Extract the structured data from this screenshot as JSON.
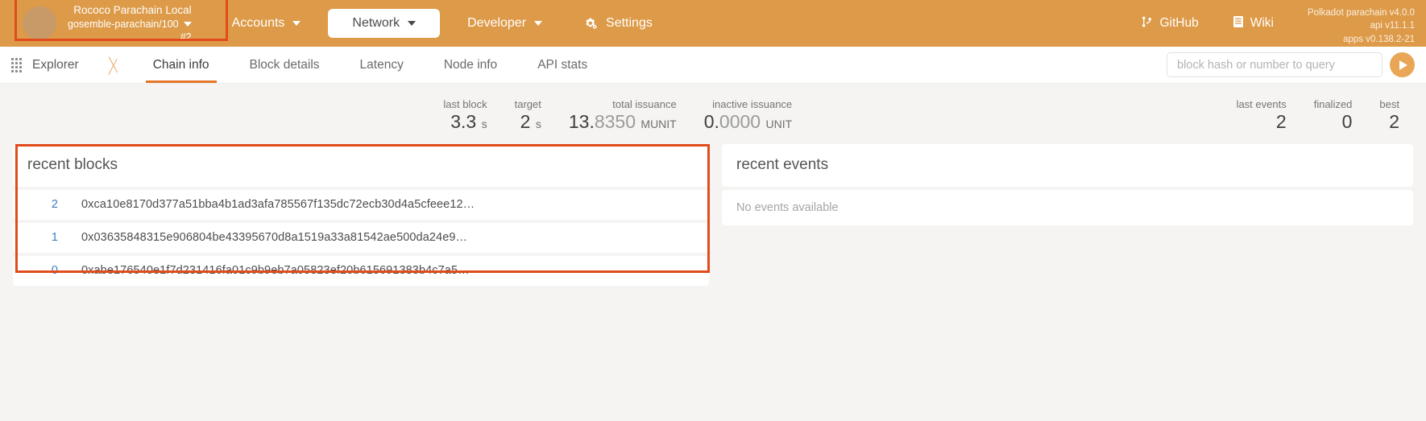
{
  "header": {
    "chain": {
      "name": "Rococo Parachain Local",
      "spec": "gosemble-parachain/100",
      "block": "#2",
      "caret_icon": "chevron-down-icon"
    },
    "nav": [
      {
        "label": "Accounts",
        "active": false,
        "caret": true
      },
      {
        "label": "Network",
        "active": true,
        "caret": true
      },
      {
        "label": "Developer",
        "active": false,
        "caret": true
      },
      {
        "label": "Settings",
        "active": false,
        "caret": false,
        "icon": "gear-icon"
      }
    ],
    "links": [
      {
        "label": "GitHub",
        "icon": "git-branch-icon"
      },
      {
        "label": "Wiki",
        "icon": "book-icon"
      }
    ],
    "versions": [
      "Polkadot parachain v4.0.0",
      "api v11.1.1",
      "apps v0.138.2-21"
    ],
    "bar_color": "#dd9a48",
    "highlight_color": "#e24b1b"
  },
  "tabbar": {
    "breadcrumb": {
      "label": "Explorer",
      "icon": "apps-grid-icon"
    },
    "tabs": [
      {
        "label": "Chain info",
        "active": true
      },
      {
        "label": "Block details",
        "active": false
      },
      {
        "label": "Latency",
        "active": false
      },
      {
        "label": "Node info",
        "active": false
      },
      {
        "label": "API stats",
        "active": false
      }
    ],
    "search": {
      "value": "",
      "placeholder": "block hash or number to query",
      "submit_icon": "play-arrow-icon"
    },
    "active_underline_color": "#e4762a"
  },
  "summary": {
    "left": [
      {
        "label": "last block",
        "value": "3.3",
        "unit": "s"
      },
      {
        "label": "target",
        "value": "2",
        "unit": "s"
      },
      {
        "label": "total issuance",
        "value_strong": "13.",
        "value_dim": "8350",
        "unit": "MUNIT"
      },
      {
        "label": "inactive issuance",
        "value_strong": "0.",
        "value_dim": "0000",
        "unit": "UNIT"
      }
    ],
    "right": [
      {
        "label": "last events",
        "value": "2"
      },
      {
        "label": "finalized",
        "value": "0"
      },
      {
        "label": "best",
        "value": "2"
      }
    ]
  },
  "recent_blocks": {
    "title": "recent blocks",
    "rows": [
      {
        "number": "2",
        "hash": "0xca10e8170d377a51bba4b1ad3afa785567f135dc72ecb30d4a5cfeee12…"
      },
      {
        "number": "1",
        "hash": "0x03635848315e906804be43395670d8a1519a33a81542ae500da24e9…"
      },
      {
        "number": "0",
        "hash": "0xabe176540e1f7d231416fa01c9b9eb7a05823ef20b615691383b4c7a5…"
      }
    ]
  },
  "recent_events": {
    "title": "recent events",
    "empty_text": "No events available"
  }
}
